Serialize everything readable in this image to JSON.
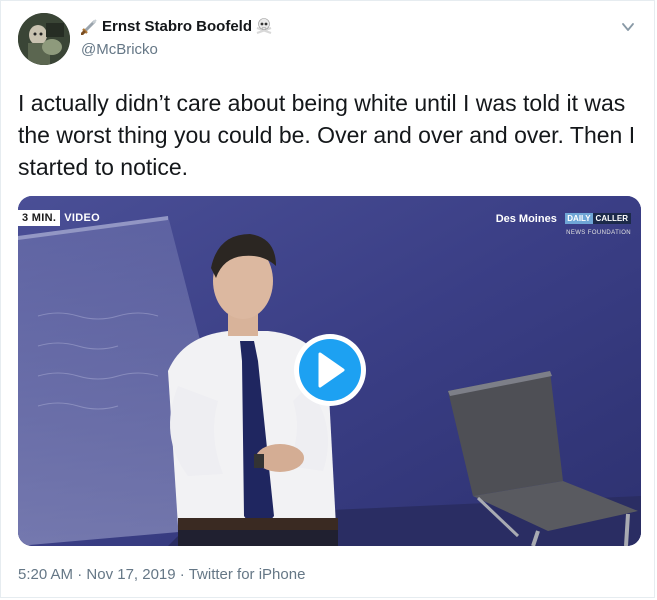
{
  "author": {
    "display_name": "Ernst Stabro Boofeld",
    "handle": "@McBricko",
    "name_prefix_icon": "dagger-icon",
    "name_suffix_icon": "skull-crossbones-icon"
  },
  "tweet": {
    "text": "I actually didn’t care about being white until I was told it was the worst thing you could be. Over and over and over. Then I started to notice."
  },
  "video": {
    "badge_box": "3 MIN.",
    "badge_text": "VIDEO",
    "brand_city": "Des Moines",
    "brand_logo_a": "DAILY",
    "brand_logo_b": "CALLER",
    "brand_sub": "NEWS FOUNDATION",
    "play_icon": "play-icon"
  },
  "meta": {
    "time": "5:20 AM",
    "date": "Nov 17, 2019",
    "source": "Twitter for iPhone",
    "separator": "·"
  },
  "colors": {
    "accent": "#1da1f2",
    "secondary_text": "#657786",
    "primary_text": "#14171a"
  }
}
